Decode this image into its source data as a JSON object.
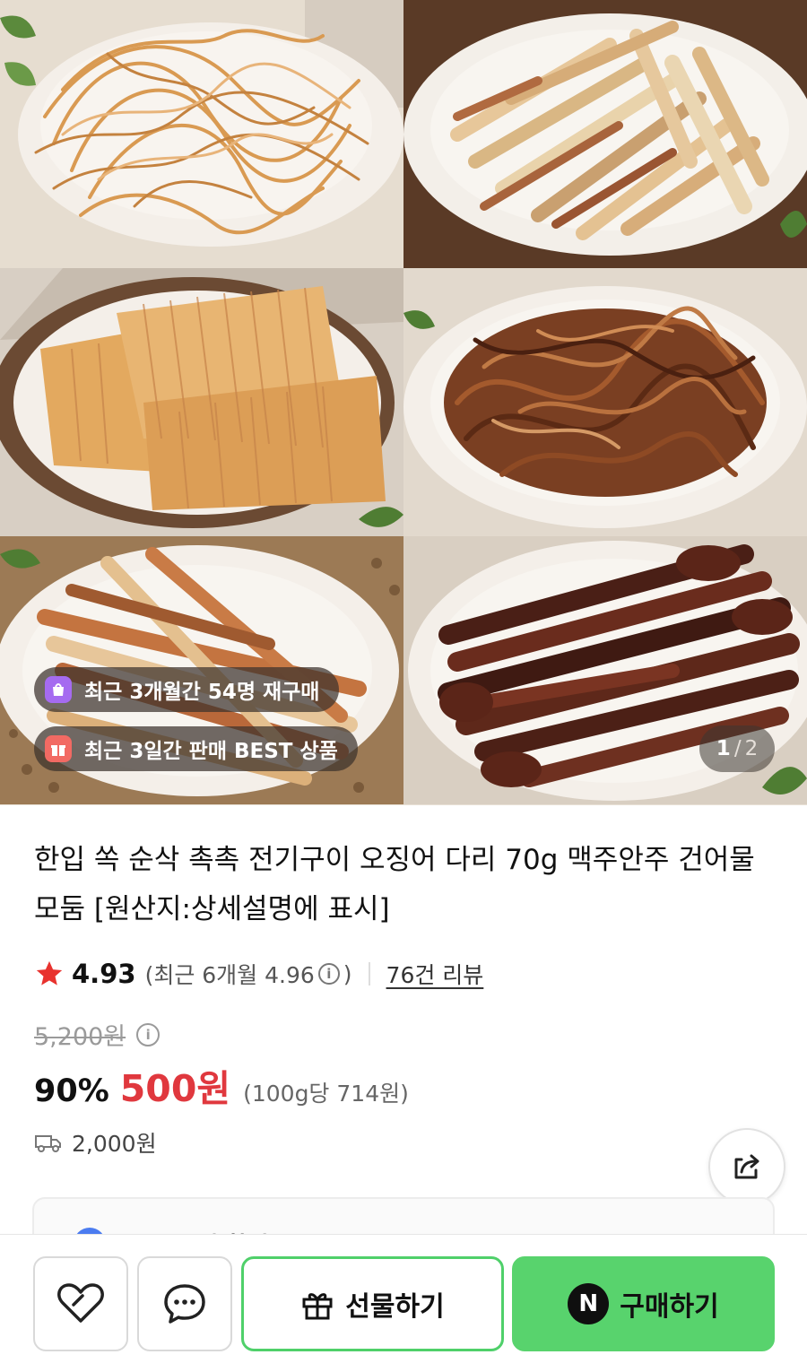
{
  "hero": {
    "tiles": [
      {
        "name": "shredded-squid"
      },
      {
        "name": "squid-sticks"
      },
      {
        "name": "grilled-squid-sheets"
      },
      {
        "name": "seasoned-squid-strands"
      },
      {
        "name": "roasted-squid-strips"
      },
      {
        "name": "squid-legs"
      }
    ],
    "badges": [
      {
        "icon": "shopping-bag-icon",
        "text": "최근 3개월간 54명 재구매"
      },
      {
        "icon": "gift-box-icon",
        "text": "최근 3일간 판매 BEST 상품"
      }
    ],
    "pager": {
      "current": "1",
      "separator": "/",
      "total": "2"
    }
  },
  "product": {
    "title": "한입 쏙 순삭 촉촉 전기구이 오징어 다리 70g 맥주안주 건어물 모둠 [원산지:상세설명에 표시]",
    "rating": {
      "value": "4.93",
      "recent_prefix": "(최근 6개월 4.96",
      "recent_suffix": ")",
      "info_glyph": "i",
      "reviews": "76건 리뷰"
    },
    "original_price": "5,200원",
    "discount": "90%",
    "price": "500원",
    "unit_price": "(100g당 714원)",
    "shipping": "2,000원",
    "peek_card_text": "복수 구매 할인"
  },
  "bottom_bar": {
    "gift_label": "선물하기",
    "buy_logo": "N",
    "buy_label": "구매하기"
  },
  "colors": {
    "sale_red": "#e0383e",
    "naver_green": "#58d36d",
    "badge_purple": "#a56bf0",
    "badge_red": "#f26a63"
  }
}
